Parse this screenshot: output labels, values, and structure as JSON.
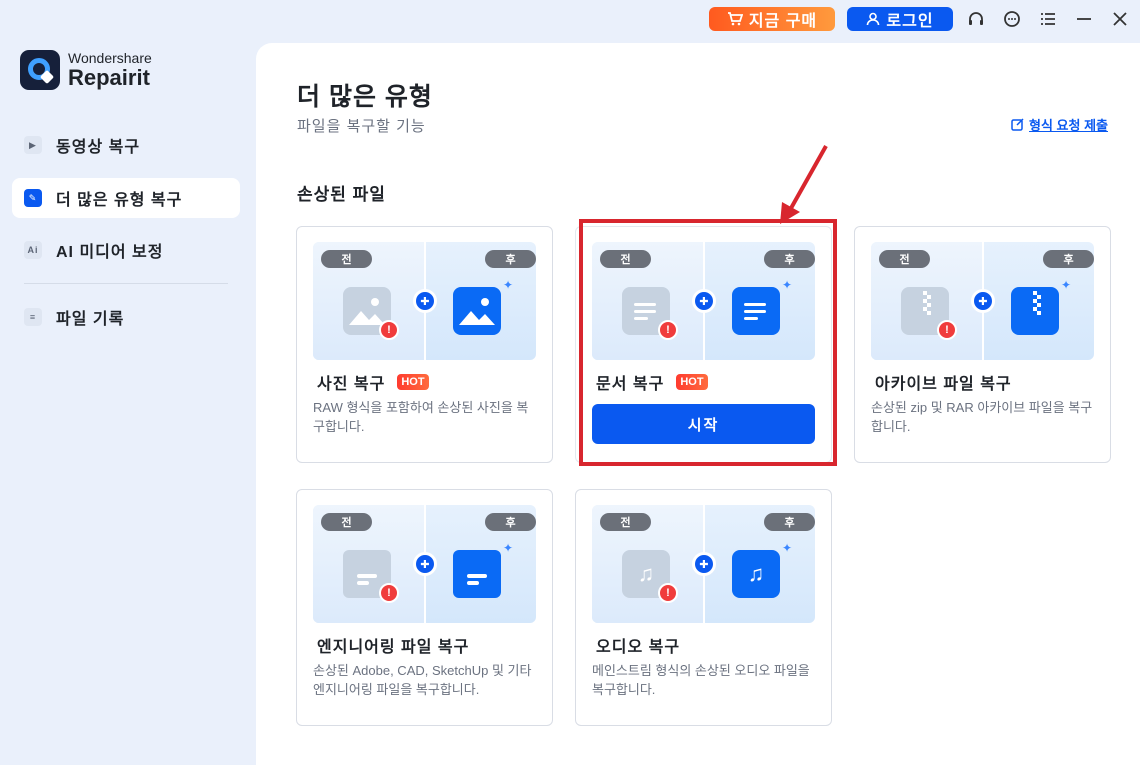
{
  "titlebar": {
    "buy_label": "지금 구매",
    "login_label": "로그인"
  },
  "app": {
    "brand_line1": "Wondershare",
    "brand_line2": "Repairit"
  },
  "sidebar": {
    "items": [
      {
        "label": "동영상 복구",
        "icon": "video-icon",
        "active": false
      },
      {
        "label": "더 많은 유형 복구",
        "icon": "wrench-icon",
        "active": true
      },
      {
        "label": "AI 미디어 보정",
        "icon": "ai-icon",
        "active": false
      },
      {
        "label": "파일 기록",
        "icon": "list-icon",
        "active": false
      }
    ]
  },
  "main": {
    "title": "더 많은 유형",
    "subtitle": "파일을 복구할 기능",
    "request_link": "형식 요청 제출",
    "section_title": "손상된 파일",
    "before_tag": "전",
    "after_tag": "후",
    "hot_badge": "HOT",
    "cards": [
      {
        "title": "사진 복구",
        "hot": true,
        "desc": "RAW 형식을 포함하여 손상된 사진을 복구합니다.",
        "icon": "image-icon"
      },
      {
        "title": "문서 복구",
        "hot": true,
        "start_label": "시작",
        "icon": "document-icon",
        "highlighted": true
      },
      {
        "title": "아카이브 파일 복구",
        "hot": false,
        "desc": "손상된 zip 및 RAR 아카이브 파일을 복구합니다.",
        "icon": "archive-icon"
      },
      {
        "title": "엔지니어링 파일 복구",
        "hot": false,
        "desc": "손상된 Adobe, CAD, SketchUp 및 기타 엔지니어링 파일을 복구합니다.",
        "icon": "folder-icon"
      },
      {
        "title": "오디오 복구",
        "hot": false,
        "desc": "메인스트림 형식의 손상된 오디오 파일을 복구합니다.",
        "icon": "music-icon"
      }
    ]
  },
  "colors": {
    "accent": "#0a59f0",
    "buy_gradient_start": "#ff5a1f",
    "highlight": "#d8262e",
    "sidebar_bg": "#eaf0fb"
  }
}
